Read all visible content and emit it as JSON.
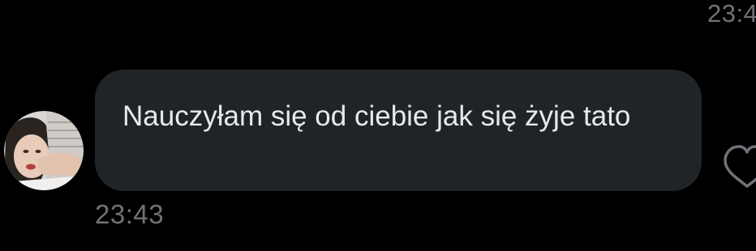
{
  "chat": {
    "previous_message_time": "23:4",
    "message": {
      "text": "Nauczyłam się od ciebie jak się żyje tato",
      "time": "23:43",
      "sender_avatar": "profile-photo",
      "reaction_icon": "heart-outline-icon"
    }
  },
  "colors": {
    "background": "#000000",
    "bubble": "#212427",
    "message_text": "#e7e9ea",
    "timestamp": "#6f7377"
  }
}
